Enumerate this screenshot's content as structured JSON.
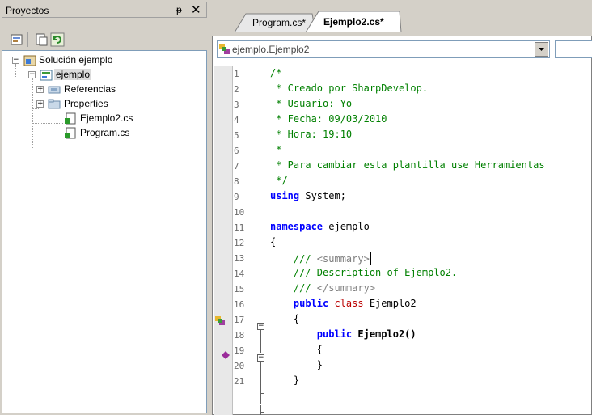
{
  "left_panel": {
    "title": "Proyectos",
    "pin": "ᵽ",
    "close": "✕",
    "tree": {
      "solution": "Solución ejemplo",
      "project": "ejemplo",
      "references": "Referencias",
      "properties": "Properties",
      "file1": "Ejemplo2.cs",
      "file2": "Program.cs"
    }
  },
  "tabs": [
    {
      "label": "Program.cs*"
    },
    {
      "label": "Ejemplo2.cs*"
    }
  ],
  "navbar": {
    "class_combo": "ejemplo.Ejemplo2"
  },
  "code": {
    "line_numbers": [
      "1",
      "2",
      "3",
      "4",
      "5",
      "6",
      "7",
      "8",
      "9",
      "10",
      "11",
      "12",
      "13",
      "14",
      "15",
      "16",
      "17",
      "18",
      "19",
      "20",
      "21"
    ],
    "l1": "/*",
    "l2": " * Creado por SharpDevelop.",
    "l3": " * Usuario: Yo",
    "l4": " * Fecha: 09/03/2010",
    "l5": " * Hora: 19:10",
    "l6": " *",
    "l7": " * Para cambiar esta plantilla use Herramientas",
    "l8": " */",
    "l9_kw": "using",
    "l9_rest": " System;",
    "l11_kw": "namespace",
    "l11_rest": " ejemplo",
    "l12": "{",
    "l13_a": "    /// ",
    "l13_tag": "<summary>",
    "l14": "    /// Description of Ejemplo2.",
    "l15_a": "    /// ",
    "l15_tag": "</summary>",
    "l16_kw": "    public",
    "l16_kw2": " class",
    "l16_rest": " Ejemplo2",
    "l17": "    {",
    "l18_kw": "        public",
    "l18_rest": " Ejemplo2()",
    "l19": "        {",
    "l20": "        }",
    "l21": "    }"
  },
  "colors": {
    "comment": "#008000",
    "keyword": "#0000ff",
    "class_keyword": "#bb0000"
  }
}
